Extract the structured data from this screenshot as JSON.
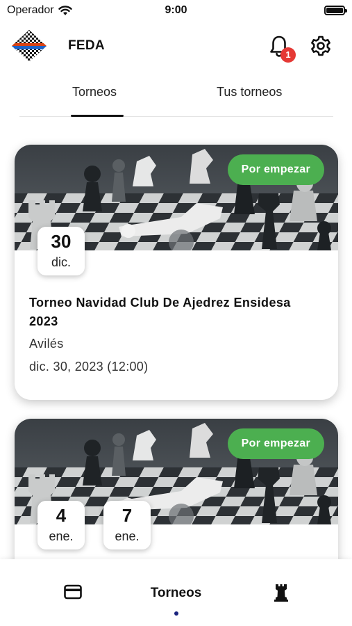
{
  "status_bar": {
    "carrier": "Operador",
    "time": "9:00"
  },
  "app_bar": {
    "title": "FEDA",
    "notification_count": "1"
  },
  "tabs": [
    {
      "label": "Torneos",
      "active": true
    },
    {
      "label": "Tus torneos",
      "active": false
    }
  ],
  "tournaments": [
    {
      "status": "Por empezar",
      "date_boxes": [
        {
          "day": "30",
          "month": "dic."
        }
      ],
      "title": "Torneo Navidad Club De Ajedrez Ensidesa 2023",
      "city": "Avilés",
      "datetime": "dic. 30, 2023 (12:00)"
    },
    {
      "status": "Por empezar",
      "date_boxes": [
        {
          "day": "4",
          "month": "ene."
        },
        {
          "day": "7",
          "month": "ene."
        }
      ]
    }
  ],
  "bottom_nav": {
    "items": [
      {
        "icon": "card-icon"
      },
      {
        "label": "Torneos",
        "active": true
      },
      {
        "icon": "chess-rook-icon"
      }
    ]
  },
  "colors": {
    "status_green": "#4caf50",
    "badge_red": "#e53935",
    "active_dot": "#1a237e"
  }
}
